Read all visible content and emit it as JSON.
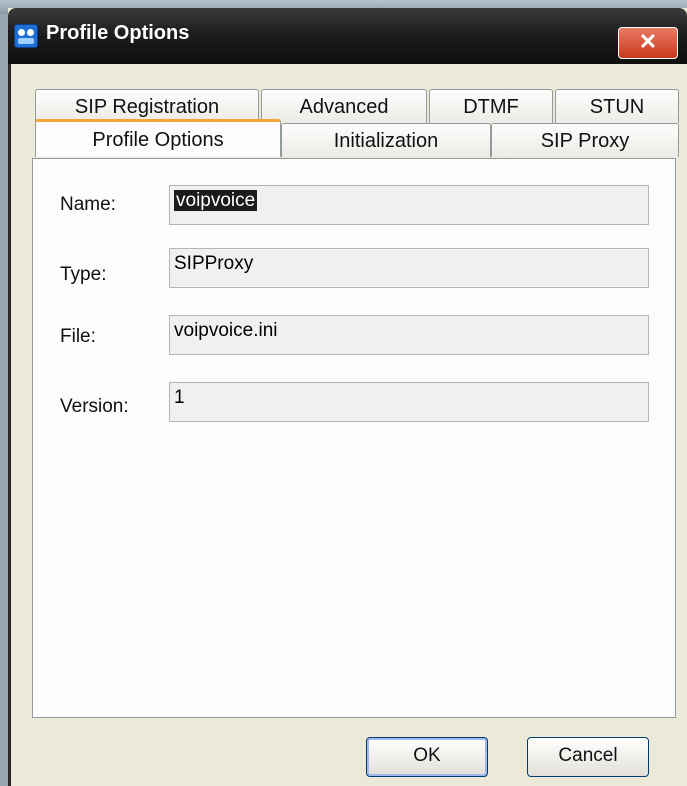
{
  "window": {
    "title": "Profile Options",
    "close_label": "✕"
  },
  "tabs": {
    "row_back": [
      "SIP Registration",
      "Advanced",
      "DTMF",
      "STUN"
    ],
    "row_front": [
      "Profile Options",
      "Initialization",
      "SIP Proxy"
    ],
    "active": "Profile Options"
  },
  "fields": {
    "name": {
      "label": "Name:",
      "value": "voipvoice"
    },
    "type": {
      "label": "Type:",
      "value": "SIPProxy"
    },
    "file": {
      "label": "File:",
      "value": "voipvoice.ini"
    },
    "version": {
      "label": "Version:",
      "value": "1"
    }
  },
  "buttons": {
    "ok": "OK",
    "cancel": "Cancel"
  }
}
